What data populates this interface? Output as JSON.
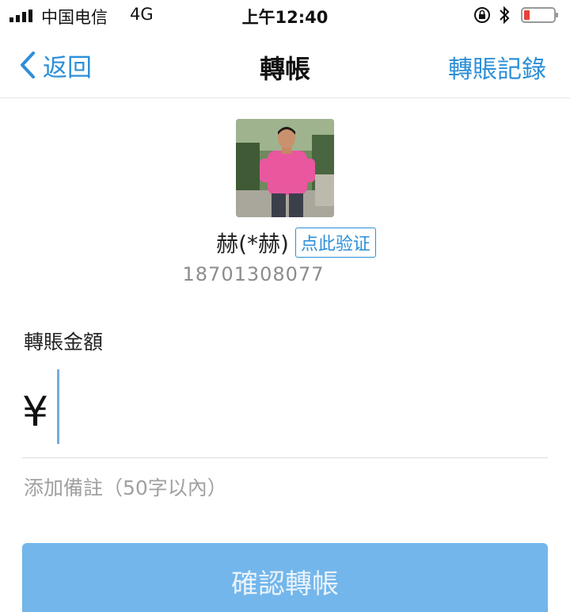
{
  "status_bar": {
    "carrier": "中国电信",
    "network": "4G",
    "time": "上午12:40",
    "icons": [
      "signal-icon",
      "orientation-lock-icon",
      "bluetooth-icon",
      "battery-low-icon"
    ]
  },
  "nav": {
    "back_label": "返回",
    "title": "轉帳",
    "right_label": "轉賬記錄"
  },
  "payee": {
    "name": "赫(*赫)",
    "verify_label": "点此验证",
    "phone": "18701308077"
  },
  "amount": {
    "label": "轉賬金額",
    "currency_symbol": "¥",
    "value": ""
  },
  "remark": {
    "placeholder": "添加備註（50字以內）"
  },
  "confirm": {
    "label": "確認轉帳"
  },
  "colors": {
    "accent": "#2c8fd8",
    "button_bg": "#73b6eb",
    "battery_low": "#e8413b"
  }
}
